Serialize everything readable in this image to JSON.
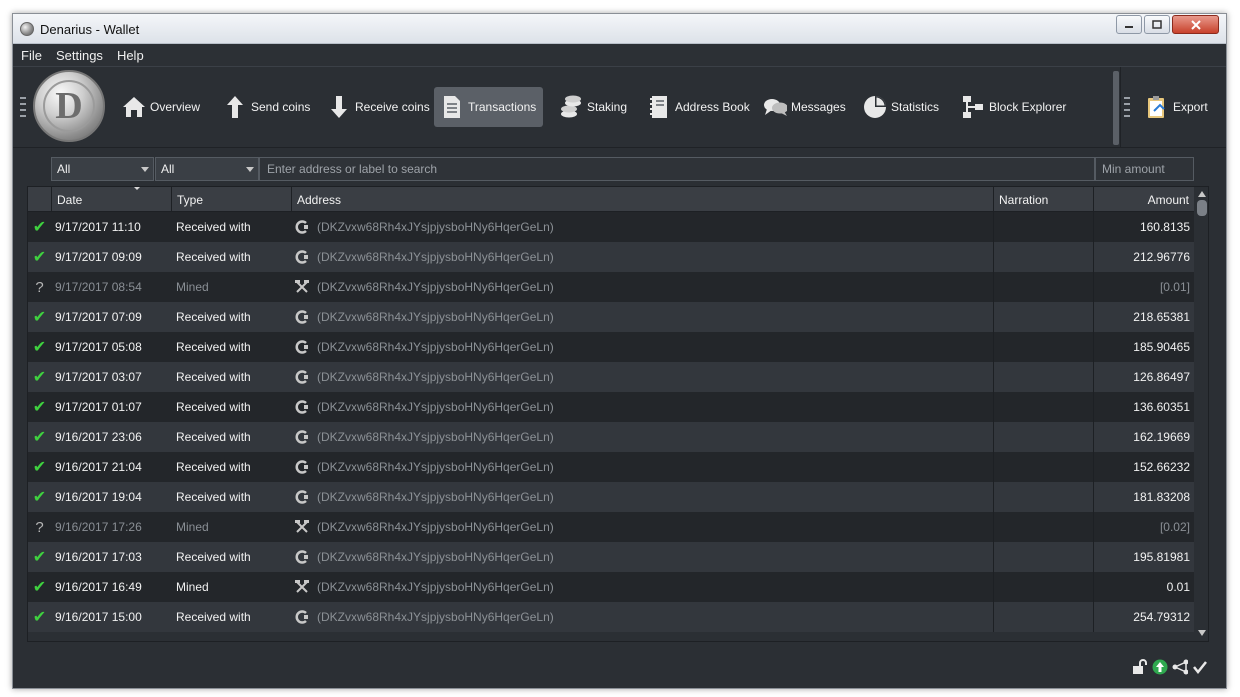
{
  "window": {
    "title": "Denarius - Wallet"
  },
  "menu": [
    "File",
    "Settings",
    "Help"
  ],
  "toolbar": {
    "logo_letter": "D",
    "buttons": [
      {
        "label": "Overview",
        "icon": "home-icon"
      },
      {
        "label": "Send coins",
        "icon": "arrow-up-icon"
      },
      {
        "label": "Receive coins",
        "icon": "arrow-down-icon"
      },
      {
        "label": "Transactions",
        "icon": "document-icon",
        "active": true
      },
      {
        "label": "Staking",
        "icon": "coins-icon"
      },
      {
        "label": "Address Book",
        "icon": "address-book-icon"
      },
      {
        "label": "Messages",
        "icon": "chat-icon"
      },
      {
        "label": "Statistics",
        "icon": "pie-chart-icon"
      },
      {
        "label": "Block Explorer",
        "icon": "block-tree-icon"
      }
    ],
    "export_label": "Export"
  },
  "filters": {
    "date_filter": "All",
    "type_filter": "All",
    "search_placeholder": "Enter address or label to search",
    "amount_placeholder": "Min amount"
  },
  "table": {
    "columns": [
      "Date",
      "Type",
      "Address",
      "Narration",
      "Amount"
    ],
    "rows": [
      {
        "status": "confirmed",
        "date": "9/17/2017 11:10",
        "type": "Received with",
        "address": "(DKZvxw68Rh4xJYsjpjysboHNy6HqerGeLn)",
        "narration": "",
        "amount": "160.8135"
      },
      {
        "status": "confirmed",
        "date": "9/17/2017 09:09",
        "type": "Received with",
        "address": "(DKZvxw68Rh4xJYsjpjysboHNy6HqerGeLn)",
        "narration": "",
        "amount": "212.96776"
      },
      {
        "status": "unconfirmed",
        "date": "9/17/2017 08:54",
        "type": "Mined",
        "address": "(DKZvxw68Rh4xJYsjpjysboHNy6HqerGeLn)",
        "narration": "",
        "amount": "[0.01]"
      },
      {
        "status": "confirmed",
        "date": "9/17/2017 07:09",
        "type": "Received with",
        "address": "(DKZvxw68Rh4xJYsjpjysboHNy6HqerGeLn)",
        "narration": "",
        "amount": "218.65381"
      },
      {
        "status": "confirmed",
        "date": "9/17/2017 05:08",
        "type": "Received with",
        "address": "(DKZvxw68Rh4xJYsjpjysboHNy6HqerGeLn)",
        "narration": "",
        "amount": "185.90465"
      },
      {
        "status": "confirmed",
        "date": "9/17/2017 03:07",
        "type": "Received with",
        "address": "(DKZvxw68Rh4xJYsjpjysboHNy6HqerGeLn)",
        "narration": "",
        "amount": "126.86497"
      },
      {
        "status": "confirmed",
        "date": "9/17/2017 01:07",
        "type": "Received with",
        "address": "(DKZvxw68Rh4xJYsjpjysboHNy6HqerGeLn)",
        "narration": "",
        "amount": "136.60351"
      },
      {
        "status": "confirmed",
        "date": "9/16/2017 23:06",
        "type": "Received with",
        "address": "(DKZvxw68Rh4xJYsjpjysboHNy6HqerGeLn)",
        "narration": "",
        "amount": "162.19669"
      },
      {
        "status": "confirmed",
        "date": "9/16/2017 21:04",
        "type": "Received with",
        "address": "(DKZvxw68Rh4xJYsjpjysboHNy6HqerGeLn)",
        "narration": "",
        "amount": "152.66232"
      },
      {
        "status": "confirmed",
        "date": "9/16/2017 19:04",
        "type": "Received with",
        "address": "(DKZvxw68Rh4xJYsjpjysboHNy6HqerGeLn)",
        "narration": "",
        "amount": "181.83208"
      },
      {
        "status": "unconfirmed",
        "date": "9/16/2017 17:26",
        "type": "Mined",
        "address": "(DKZvxw68Rh4xJYsjpjysboHNy6HqerGeLn)",
        "narration": "",
        "amount": "[0.02]"
      },
      {
        "status": "confirmed",
        "date": "9/16/2017 17:03",
        "type": "Received with",
        "address": "(DKZvxw68Rh4xJYsjpjysboHNy6HqerGeLn)",
        "narration": "",
        "amount": "195.81981"
      },
      {
        "status": "confirmed",
        "date": "9/16/2017 16:49",
        "type": "Mined",
        "address": "(DKZvxw68Rh4xJYsjpjysboHNy6HqerGeLn)",
        "narration": "",
        "amount": "0.01"
      },
      {
        "status": "confirmed",
        "date": "9/16/2017 15:00",
        "type": "Received with",
        "address": "(DKZvxw68Rh4xJYsjpjysboHNy6HqerGeLn)",
        "narration": "",
        "amount": "254.79312"
      }
    ]
  },
  "statusbar": {
    "icons": [
      "lock-open-icon",
      "staking-arrow-icon",
      "network-icon",
      "synced-check-icon"
    ],
    "colors": {
      "staking": "#2fa84f",
      "confirmed": "#3fd13f"
    }
  }
}
